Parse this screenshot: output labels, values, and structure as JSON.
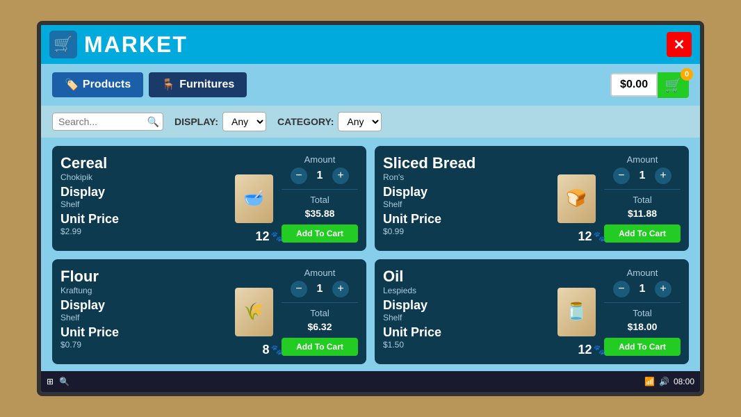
{
  "app": {
    "title": "MARKET",
    "close_label": "✕"
  },
  "nav": {
    "products_label": "Products",
    "furnitures_label": "Furnitures"
  },
  "cart": {
    "price": "$0.00",
    "badge": "0"
  },
  "search": {
    "placeholder": "Search...",
    "display_label": "DISPLAY:",
    "display_option": "Any",
    "category_label": "CATEGORY:",
    "category_option": "Any"
  },
  "products": [
    {
      "name": "Cereal",
      "brand": "Chokipik",
      "display": "Display",
      "display_sub": "Shelf",
      "unit_label": "Unit Price",
      "unit_price": "$2.99",
      "stock": "12",
      "amount": "1",
      "total_label": "Total",
      "total_value": "$35.88",
      "add_label": "Add To Cart",
      "image_emoji": "🥣"
    },
    {
      "name": "Sliced Bread",
      "brand": "Ron's",
      "display": "Display",
      "display_sub": "Shelf",
      "unit_label": "Unit Price",
      "unit_price": "$0.99",
      "stock": "12",
      "amount": "1",
      "total_label": "Total",
      "total_value": "$11.88",
      "add_label": "Add To Cart",
      "image_emoji": "🍞"
    },
    {
      "name": "Flour",
      "brand": "Kraftung",
      "display": "Display",
      "display_sub": "Shelf",
      "unit_label": "Unit Price",
      "unit_price": "$0.79",
      "stock": "8",
      "amount": "1",
      "total_label": "Total",
      "total_value": "$6.32",
      "add_label": "Add To Cart",
      "image_emoji": "🌾"
    },
    {
      "name": "Oil",
      "brand": "Lespieds",
      "display": "Display",
      "display_sub": "Shelf",
      "unit_label": "Unit Price",
      "unit_price": "$1.50",
      "stock": "12",
      "amount": "1",
      "total_label": "Total",
      "total_value": "$18.00",
      "add_label": "Add To Cart",
      "image_emoji": "🫙"
    }
  ],
  "taskbar": {
    "time": "08:00",
    "date": "▲"
  }
}
